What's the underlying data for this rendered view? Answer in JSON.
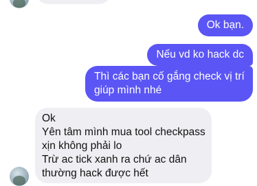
{
  "conversation": {
    "messages": [
      {
        "from": "contact",
        "lines": []
      },
      {
        "from": "me",
        "lines": [
          "Ok bạn."
        ]
      },
      {
        "from": "me",
        "lines": [
          "Nếu vd ko hack dc"
        ]
      },
      {
        "from": "me",
        "lines": [
          "Thì các bạn cố gắng check vị trí",
          "giúp mình nhé"
        ]
      },
      {
        "from": "contact",
        "lines": [
          "Ok",
          "Yên tâm mình mua tool checkpass",
          "xịn không phải lo",
          "Trừ ac tick xanh ra chứ ac dân",
          "thường hack được hết"
        ]
      }
    ]
  },
  "colors": {
    "outgoing_bubble": "#5b55f5",
    "incoming_bubble": "#efeff3",
    "background": "#ffffff"
  }
}
